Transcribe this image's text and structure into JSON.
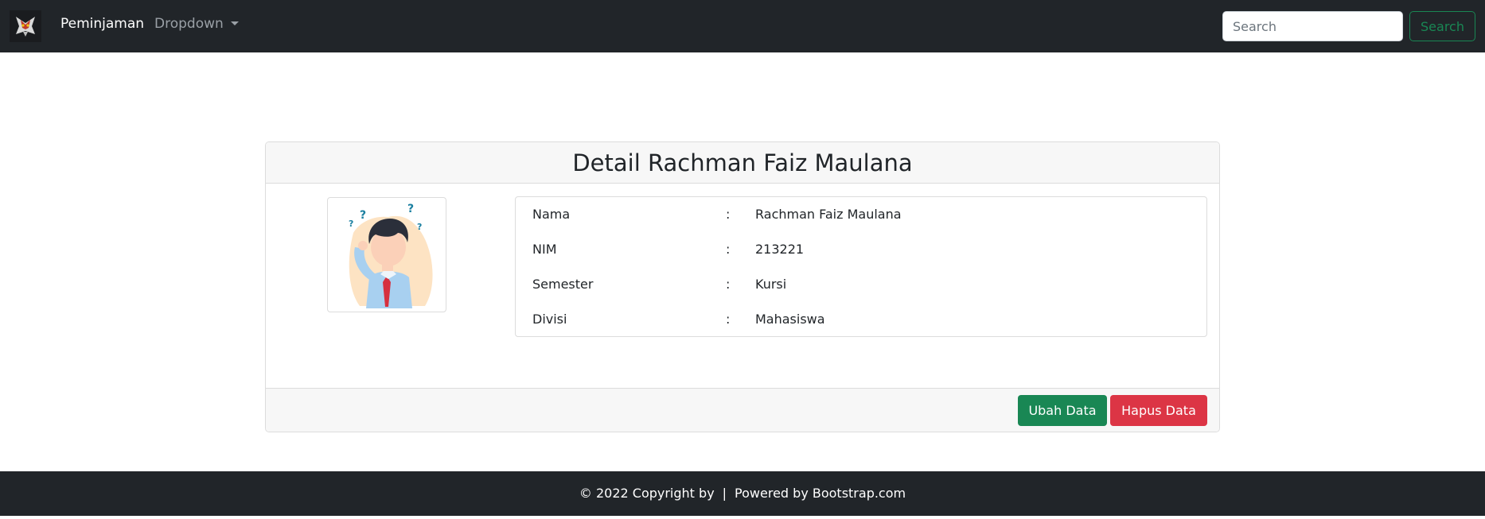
{
  "navbar": {
    "brand": "Peminjaman",
    "dropdown_label": "Dropdown",
    "search_placeholder": "Search",
    "search_button": "Search"
  },
  "card": {
    "title": "Detail Rachman Faiz Maulana",
    "fields": [
      {
        "label": "Nama",
        "separator": ":",
        "value": "Rachman Faiz Maulana"
      },
      {
        "label": "NIM",
        "separator": ":",
        "value": "213221"
      },
      {
        "label": "Semester",
        "separator": ":",
        "value": "Kursi"
      },
      {
        "label": "Divisi",
        "separator": ":",
        "value": "Mahasiswa"
      }
    ],
    "buttons": {
      "edit": "Ubah Data",
      "delete": "Hapus Data"
    }
  },
  "footer": {
    "copyright": "© 2022 Copyright by",
    "separator": "|",
    "powered": "Powered by Bootstrap.com"
  },
  "colors": {
    "navbar_bg": "#212529",
    "success": "#198754",
    "danger": "#dc3545"
  },
  "icons": {
    "brand_logo": "robot-logo-icon",
    "avatar": "confused-person-illustration"
  }
}
